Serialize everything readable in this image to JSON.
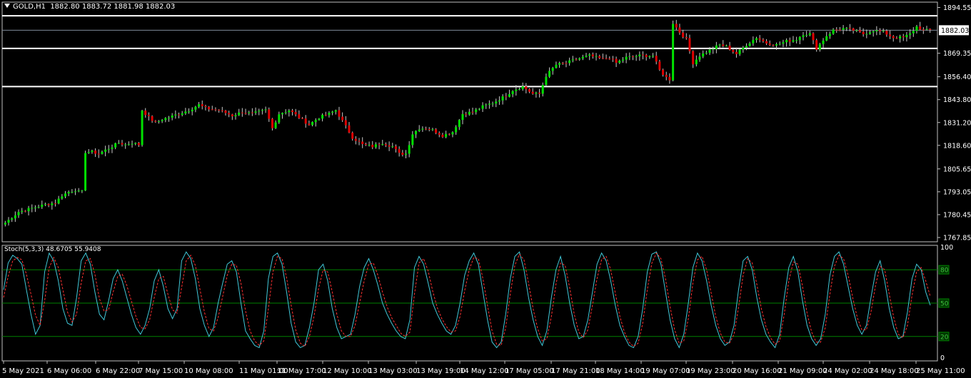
{
  "header": {
    "symbol": "GOLD,H1",
    "ohlc": "1882.80 1883.72 1881.98 1882.03"
  },
  "stoch_header": {
    "label": "Stoch(5,3,3) 48.6705 55.9408"
  },
  "price_badge": "1882.03",
  "colors": {
    "background": "#000000",
    "bull": "#00e000",
    "bear": "#e00000",
    "wick": "#c8c8c8",
    "grid_frame": "#ffffff",
    "main_line": "#40c8d8",
    "signal_line": "#ff3030",
    "level_line": "#008000"
  },
  "chart_data": [
    {
      "type": "candlestick",
      "title": "GOLD,H1",
      "y_ticks": [
        "1894.55",
        "1882.03",
        "1869.35",
        "1856.40",
        "1843.80",
        "1831.20",
        "1818.60",
        "1805.65",
        "1793.05",
        "1780.45",
        "1767.85"
      ],
      "ylim": [
        1765.5,
        1897.5
      ],
      "x_ticks": [
        "5 May 2021",
        "6 May 06:00",
        "6 May 22:00",
        "7 May 15:00",
        "10 May 08:00",
        "11 May 01:00",
        "11 May 17:00",
        "12 May 10:00",
        "13 May 03:00",
        "13 May 19:00",
        "14 May 12:00",
        "17 May 05:00",
        "17 May 21:00",
        "18 May 14:00",
        "19 May 07:00",
        "19 May 23:00",
        "20 May 16:00",
        "21 May 09:00",
        "24 May 02:00",
        "24 May 18:00",
        "25 May 11:00"
      ],
      "last_price": 1882.03,
      "horizontal_levels": [
        1890.0,
        1872.0,
        1851.0
      ],
      "close_path": [
        [
          0,
          1776
        ],
        [
          4,
          1782
        ],
        [
          8,
          1784
        ],
        [
          12,
          1786
        ],
        [
          15,
          1787
        ],
        [
          17,
          1791
        ],
        [
          19,
          1793
        ],
        [
          21,
          1794
        ],
        [
          22,
          1793
        ],
        [
          23,
          1793
        ],
        [
          24,
          1815
        ],
        [
          26,
          1815
        ],
        [
          28,
          1814
        ],
        [
          30,
          1816
        ],
        [
          32,
          1818
        ],
        [
          34,
          1820
        ],
        [
          36,
          1819
        ],
        [
          38,
          1820
        ],
        [
          40,
          1819
        ],
        [
          41,
          1838
        ],
        [
          43,
          1834
        ],
        [
          45,
          1831
        ],
        [
          47,
          1833
        ],
        [
          49,
          1834
        ],
        [
          52,
          1836
        ],
        [
          55,
          1838
        ],
        [
          58,
          1841
        ],
        [
          60,
          1839
        ],
        [
          64,
          1838
        ],
        [
          68,
          1835
        ],
        [
          71,
          1837
        ],
        [
          74,
          1836
        ],
        [
          78,
          1838
        ],
        [
          80,
          1828
        ],
        [
          82,
          1836
        ],
        [
          85,
          1838
        ],
        [
          88,
          1834
        ],
        [
          91,
          1830
        ],
        [
          94,
          1834
        ],
        [
          97,
          1836
        ],
        [
          99,
          1838
        ],
        [
          101,
          1832
        ],
        [
          104,
          1823
        ],
        [
          107,
          1819
        ],
        [
          110,
          1818
        ],
        [
          113,
          1820
        ],
        [
          116,
          1818
        ],
        [
          118,
          1814
        ],
        [
          120,
          1814
        ],
        [
          122,
          1825
        ],
        [
          124,
          1828
        ],
        [
          126,
          1828
        ],
        [
          128,
          1827
        ],
        [
          131,
          1824
        ],
        [
          134,
          1826
        ],
        [
          137,
          1836
        ],
        [
          140,
          1837
        ],
        [
          143,
          1840
        ],
        [
          146,
          1842
        ],
        [
          150,
          1846
        ],
        [
          152,
          1849
        ],
        [
          155,
          1851
        ],
        [
          158,
          1847
        ],
        [
          160,
          1847
        ],
        [
          162,
          1857
        ],
        [
          165,
          1863
        ],
        [
          168,
          1864
        ],
        [
          171,
          1866
        ],
        [
          175,
          1868
        ],
        [
          179,
          1866
        ],
        [
          181,
          1867
        ],
        [
          183,
          1864
        ],
        [
          186,
          1867
        ],
        [
          190,
          1868
        ],
        [
          194,
          1868
        ],
        [
          196,
          1860
        ],
        [
          198,
          1856
        ],
        [
          199,
          1855
        ],
        [
          200,
          1886
        ],
        [
          202,
          1881
        ],
        [
          204,
          1877
        ],
        [
          206,
          1864
        ],
        [
          208,
          1868
        ],
        [
          211,
          1871
        ],
        [
          214,
          1874
        ],
        [
          216,
          1873
        ],
        [
          219,
          1869
        ],
        [
          222,
          1874
        ],
        [
          225,
          1878
        ],
        [
          228,
          1875
        ],
        [
          231,
          1874
        ],
        [
          234,
          1876
        ],
        [
          237,
          1877
        ],
        [
          239,
          1880
        ],
        [
          241,
          1880
        ],
        [
          243,
          1872
        ],
        [
          246,
          1879
        ],
        [
          248,
          1882
        ],
        [
          251,
          1883
        ],
        [
          254,
          1882
        ],
        [
          257,
          1880
        ],
        [
          260,
          1882
        ],
        [
          263,
          1881
        ],
        [
          266,
          1878
        ],
        [
          269,
          1878
        ],
        [
          271,
          1880
        ],
        [
          273,
          1884
        ],
        [
          275,
          1882
        ],
        [
          277,
          1882
        ]
      ]
    },
    {
      "type": "line",
      "title": "Stoch(5,3,3)",
      "params": "5,3,3",
      "main_value": 48.6705,
      "signal_value": 55.9408,
      "ylim": [
        0,
        100
      ],
      "levels": [
        80,
        50,
        20
      ],
      "y_tick_labels": [
        "100",
        "80",
        "50",
        "20",
        "0"
      ],
      "series": [
        {
          "role": "main",
          "values": [
            62,
            86,
            93,
            90,
            85,
            62,
            40,
            22,
            30,
            78,
            95,
            88,
            70,
            45,
            32,
            30,
            55,
            88,
            95,
            85,
            60,
            40,
            35,
            52,
            72,
            80,
            70,
            55,
            40,
            28,
            22,
            30,
            45,
            70,
            80,
            65,
            45,
            36,
            45,
            88,
            96,
            90,
            72,
            45,
            30,
            20,
            28,
            50,
            68,
            85,
            88,
            78,
            50,
            25,
            18,
            12,
            10,
            25,
            72,
            92,
            95,
            85,
            60,
            32,
            15,
            10,
            12,
            28,
            50,
            80,
            85,
            70,
            45,
            28,
            18,
            20,
            22,
            40,
            65,
            82,
            90,
            80,
            66,
            50,
            40,
            32,
            25,
            20,
            18,
            35,
            82,
            92,
            85,
            68,
            50,
            40,
            32,
            25,
            22,
            30,
            50,
            75,
            88,
            95,
            85,
            60,
            35,
            15,
            10,
            15,
            40,
            72,
            92,
            96,
            80,
            55,
            35,
            20,
            12,
            25,
            55,
            80,
            92,
            75,
            50,
            30,
            18,
            20,
            35,
            60,
            85,
            95,
            88,
            70,
            48,
            30,
            20,
            12,
            10,
            20,
            45,
            78,
            94,
            96,
            85,
            60,
            35,
            18,
            10,
            22,
            50,
            82,
            95,
            88,
            70,
            48,
            30,
            18,
            12,
            15,
            30,
            62,
            88,
            92,
            80,
            55,
            35,
            22,
            15,
            10,
            22,
            55,
            82,
            92,
            78,
            52,
            30,
            18,
            12,
            18,
            40,
            75,
            92,
            96,
            85,
            65,
            45,
            30,
            22,
            30,
            55,
            78,
            88,
            70,
            45,
            28,
            18,
            20,
            42,
            72,
            85,
            80,
            60,
            48
          ]
        },
        {
          "role": "signal",
          "values": [
            55,
            74,
            88,
            91,
            89,
            76,
            58,
            39,
            30,
            52,
            82,
            91,
            82,
            62,
            42,
            33,
            40,
            68,
            88,
            90,
            76,
            54,
            43,
            44,
            60,
            74,
            76,
            66,
            52,
            38,
            28,
            27,
            35,
            55,
            72,
            74,
            58,
            44,
            41,
            64,
            88,
            93,
            84,
            63,
            42,
            27,
            25,
            37,
            56,
            75,
            85,
            84,
            68,
            43,
            25,
            16,
            12,
            16,
            45,
            78,
            92,
            90,
            73,
            48,
            26,
            14,
            11,
            20,
            38,
            63,
            80,
            78,
            60,
            40,
            25,
            20,
            20,
            30,
            50,
            70,
            85,
            86,
            75,
            60,
            47,
            37,
            30,
            23,
            20,
            24,
            58,
            86,
            90,
            79,
            61,
            46,
            36,
            29,
            24,
            25,
            38,
            61,
            80,
            91,
            90,
            72,
            48,
            25,
            13,
            12,
            28,
            58,
            84,
            94,
            89,
            68,
            45,
            27,
            16,
            18,
            38,
            67,
            86,
            84,
            64,
            40,
            24,
            19,
            26,
            48,
            72,
            89,
            92,
            80,
            59,
            38,
            24,
            15,
            11,
            14,
            32,
            62,
            86,
            95,
            90,
            72,
            47,
            26,
            14,
            16,
            36,
            68,
            89,
            92,
            80,
            59,
            38,
            23,
            15,
            14,
            22,
            46,
            75,
            90,
            86,
            67,
            45,
            29,
            19,
            13,
            16,
            40,
            70,
            87,
            85,
            65,
            41,
            24,
            15,
            15,
            28,
            58,
            83,
            93,
            90,
            75,
            55,
            37,
            26,
            26,
            42,
            66,
            83,
            80,
            58,
            37,
            22,
            19,
            30,
            57,
            78,
            82,
            70,
            56
          ]
        }
      ]
    }
  ]
}
